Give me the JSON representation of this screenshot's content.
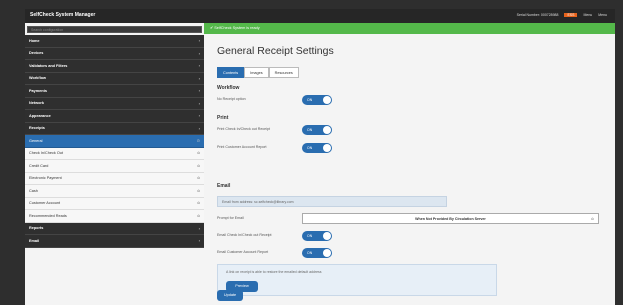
{
  "app": {
    "title": "SelfCheck System Manager",
    "top_right_text": "Serial Number: 000728988",
    "badge": "ESS",
    "user_label": "Menu",
    "logout_label": "Menu"
  },
  "sidebar": {
    "search_placeholder": "Search configuration",
    "items": [
      {
        "label": "Home",
        "kind": "dark"
      },
      {
        "label": "Devices",
        "kind": "dark"
      },
      {
        "label": "Validators and Filters",
        "kind": "dark"
      },
      {
        "label": "Workflow",
        "kind": "dark"
      },
      {
        "label": "Payments",
        "kind": "dark"
      },
      {
        "label": "Network",
        "kind": "dark"
      },
      {
        "label": "Appearance",
        "kind": "dark"
      },
      {
        "label": "Receipts",
        "kind": "dark"
      },
      {
        "label": "General",
        "kind": "active"
      },
      {
        "label": "Check In/Check Out",
        "kind": "sub"
      },
      {
        "label": "Credit Card",
        "kind": "sub"
      },
      {
        "label": "Electronic Payment",
        "kind": "sub"
      },
      {
        "label": "Cash",
        "kind": "sub"
      },
      {
        "label": "Customer Account",
        "kind": "sub"
      },
      {
        "label": "Recommended Reads",
        "kind": "sub"
      },
      {
        "label": "Reports",
        "kind": "dark"
      },
      {
        "label": "Email",
        "kind": "dark"
      }
    ]
  },
  "content": {
    "banner": "SelfCheck System is ready",
    "page_title": "General Receipt Settings",
    "tabs": [
      "Contents",
      "Images",
      "Resources"
    ],
    "workflow": {
      "heading": "Workflow",
      "no_receipt_label": "No Receipt option",
      "no_receipt_toggle": "ON"
    },
    "print": {
      "heading": "Print",
      "print_checkin_label": "Print Check In/Check out Receipt",
      "print_checkin_toggle": "ON",
      "print_account_label": "Print Customer Account Report",
      "print_account_toggle": "ON"
    },
    "email": {
      "heading": "Email",
      "address_field": "Email from address: sc.selfcheck@library.com",
      "prompt_label": "Prompt for Email",
      "prompt_value": "When Not Provided By Circulation Server",
      "email_checkin_label": "Email Check In/Check out Receipt",
      "email_checkin_toggle": "ON",
      "email_account_label": "Email Customer Account Report",
      "email_account_toggle": "ON",
      "note": "A link on receipt is able to restore the emailed default address",
      "preview_button": "Preview"
    },
    "update_button": "Update"
  }
}
